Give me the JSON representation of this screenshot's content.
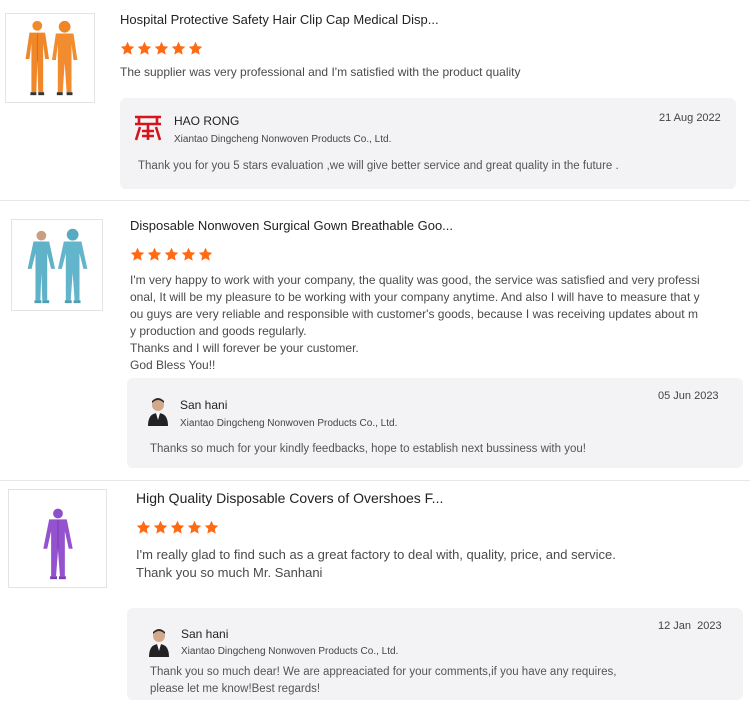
{
  "colors": {
    "star": "#ff6a13",
    "reply_bg": "#f3f3f5",
    "logo_red": "#d4161c"
  },
  "reviews": [
    {
      "product_title": "Hospital Protective Safety Hair Clip Cap Medical Disp...",
      "product_image": "orange-coverall-image",
      "rating": 5,
      "comment": "The supplier was very professional and I'm satisfied with the product quality",
      "reply": {
        "name": "HAO RONG",
        "avatar": "haorong-logo",
        "company": "Xiantao Dingcheng Nonwoven Products Co., Ltd.",
        "date": "21 Aug 2022",
        "text": "Thank you for you 5 stars evaluation ,we will give better service and great quality in the future ."
      }
    },
    {
      "product_title": "Disposable Nonwoven Surgical Gown Breathable Goo...",
      "product_image": "blue-coverall-image",
      "rating": 5,
      "comment_lines": [
        "I'm very happy to work with your company, the quality was good, the service was satisfied and very professi",
        "onal, It will be my pleasure to be working with your company anytime. And also I will have to measure that y",
        "ou guys are very reliable and responsible with customer's goods, because I was receiving updates about m",
        "y production and goods regularly.",
        "Thanks and I will forever be your customer.",
        "God Bless You!!"
      ],
      "reply": {
        "name": "San hani",
        "avatar": "person-avatar",
        "company": "Xiantao Dingcheng Nonwoven Products Co., Ltd.",
        "date": "05 Jun 2023",
        "text": "Thanks so much for your kindly feedbacks, hope to establish next bussiness with you!"
      }
    },
    {
      "product_title": "High Quality Disposable Covers of Overshoes F...",
      "product_image": "purple-coverall-image",
      "rating": 5,
      "comment_lines": [
        "I'm really glad to find such as a great factory to deal with,  quality, price, and service.",
        "Thank you so much Mr. Sanhani"
      ],
      "reply": {
        "name": "San hani",
        "avatar": "person-avatar",
        "company": "Xiantao Dingcheng Nonwoven Products Co., Ltd.",
        "date": "12 Jan  2023",
        "text_lines": [
          "Thank you so much dear! We are appreaciated for your comments,if you have any requires,",
          "please let me know!Best regards!"
        ]
      }
    }
  ]
}
